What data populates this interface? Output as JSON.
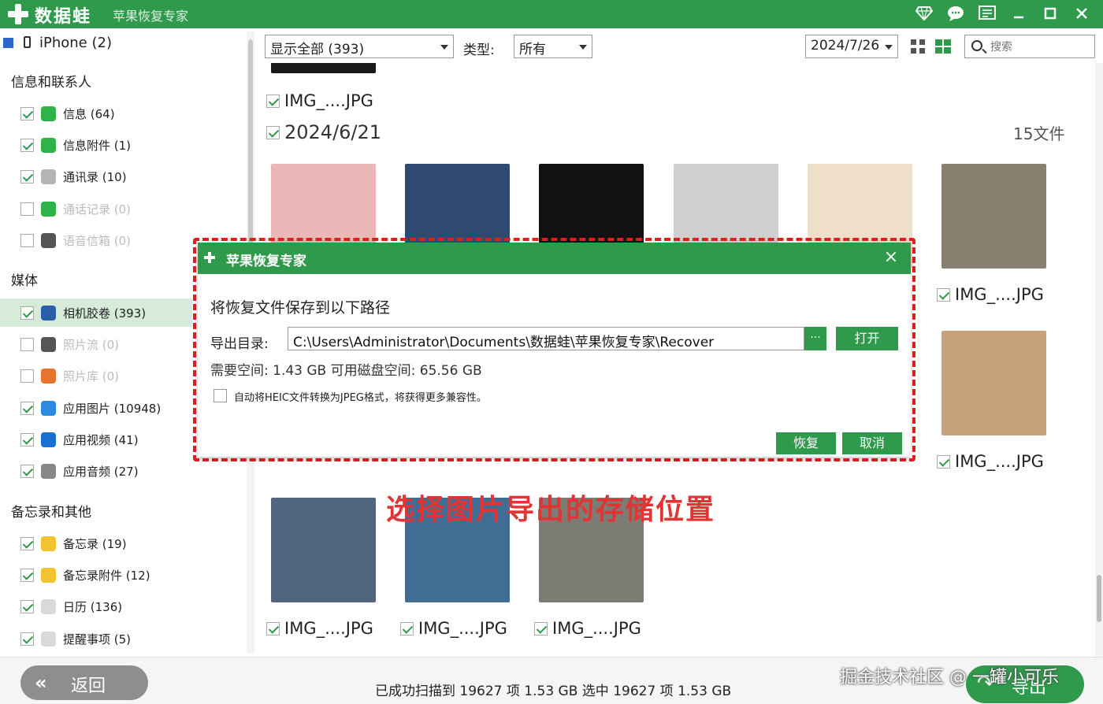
{
  "titlebar": {
    "app_name": "数据蛙",
    "subtitle": "苹果恢复专家",
    "icons": [
      "diamond-icon",
      "chat-icon",
      "feedback-icon",
      "minimize-icon",
      "maximize-icon",
      "close-icon"
    ],
    "accent": "#2f9a4c"
  },
  "sidebar": {
    "device": "iPhone (2)",
    "groups": [
      {
        "title": "信息和联系人"
      },
      {
        "title": "媒体"
      },
      {
        "title": "备忘录和其他"
      }
    ],
    "items": [
      {
        "label": "信息 (64)",
        "checked": true,
        "icon": "message-icon",
        "icon_color": "#2db34a"
      },
      {
        "label": "信息附件 (1)",
        "checked": true,
        "icon": "message-attachment-icon",
        "icon_color": "#2db34a"
      },
      {
        "label": "通讯录 (10)",
        "checked": true,
        "icon": "contacts-icon",
        "icon_color": "#b5b5b5"
      },
      {
        "label": "通话记录 (0)",
        "checked": false,
        "icon": "phone-icon",
        "icon_color": "#2db34a"
      },
      {
        "label": "语音信箱 (0)",
        "checked": false,
        "icon": "voicemail-icon",
        "icon_color": "#555555"
      },
      {
        "label": "相机胶卷 (393)",
        "checked": true,
        "icon": "camera-roll-icon",
        "icon_color": "#2b5ea8"
      },
      {
        "label": "照片流 (0)",
        "checked": false,
        "icon": "photo-stream-icon",
        "icon_color": "#555555"
      },
      {
        "label": "照片库 (0)",
        "checked": false,
        "icon": "photo-library-icon",
        "icon_color": "#e7742e"
      },
      {
        "label": "应用图片 (10948)",
        "checked": true,
        "icon": "app-photos-icon",
        "icon_color": "#2a8be0"
      },
      {
        "label": "应用视频 (41)",
        "checked": true,
        "icon": "app-videos-icon",
        "icon_color": "#1a6fd2"
      },
      {
        "label": "应用音频 (27)",
        "checked": true,
        "icon": "app-audio-icon",
        "icon_color": "#888888"
      },
      {
        "label": "备忘录 (19)",
        "checked": true,
        "icon": "notes-icon",
        "icon_color": "#f2c230"
      },
      {
        "label": "备忘录附件 (12)",
        "checked": true,
        "icon": "notes-attachment-icon",
        "icon_color": "#f2c230"
      },
      {
        "label": "日历 (136)",
        "checked": true,
        "icon": "calendar-icon",
        "icon_color": "#d9d9d9"
      },
      {
        "label": "提醒事项 (5)",
        "checked": true,
        "icon": "reminders-icon",
        "icon_color": "#d9d9d9"
      }
    ],
    "active_item": "相机胶卷 (393)"
  },
  "toolbar": {
    "filter": "显示全部 (393)",
    "type_label": "类型:",
    "type_value": "所有",
    "date_value": "2024/7/26",
    "search_placeholder": "搜索"
  },
  "content": {
    "top_file_label": "IMG_....JPG",
    "date_group": "2024/6/21",
    "group_count": "15文件",
    "file_label": "IMG_....JPG",
    "thumb_colors": [
      "#e9b7b5",
      "#2e4a70",
      "#111111",
      "#cfcfcf",
      "#efdfc9",
      "#8a8070",
      "#c7a27a",
      "#52657f",
      "#3f6d94",
      "#7c7c74"
    ]
  },
  "annotation": "选择图片导出的存储位置",
  "dialog": {
    "title": "苹果恢复专家",
    "close": "×",
    "heading": "将恢复文件保存到以下路径",
    "dir_label": "导出目录:",
    "path": "C:\\Users\\Administrator\\Documents\\数据蛙\\苹果恢复专家\\Recover",
    "browse": "···",
    "open": "打开",
    "space": "需要空间:  1.43 GB    可用磁盘空间:  65.56 GB",
    "heic": "自动将HEIC文件转换为JPEG格式，将获得更多兼容性。",
    "recover": "恢复",
    "cancel": "取消"
  },
  "bottom": {
    "back": "返回",
    "status": "已成功扫描到 19627 项 1.53 GB   选中 19627 项 1.53 GB",
    "export": "导出",
    "watermark": "掘金技术社区 @ 一罐小可乐"
  }
}
